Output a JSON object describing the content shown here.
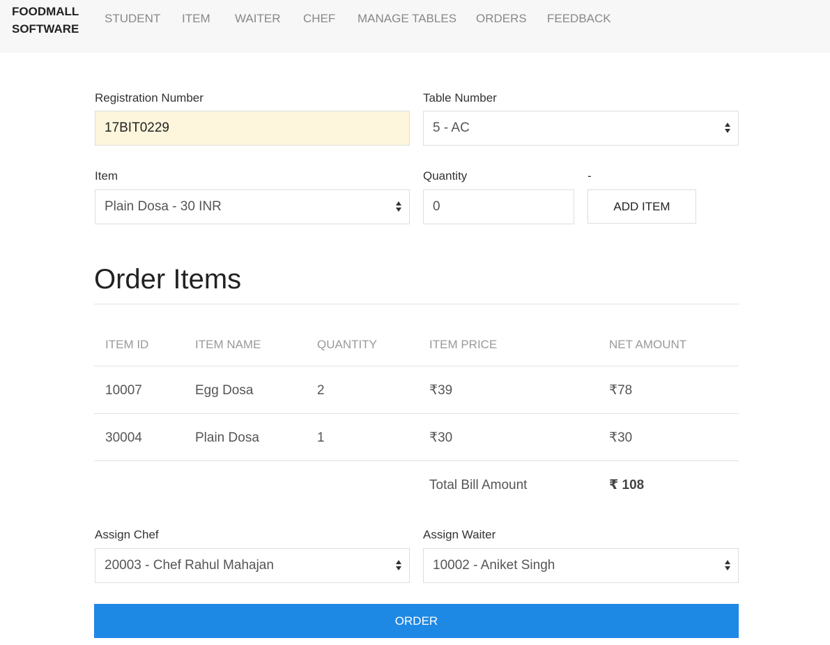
{
  "nav": {
    "brand": "FOODMALL SOFTWARE",
    "items": [
      "STUDENT",
      "ITEM",
      "WAITER",
      "CHEF",
      "MANAGE TABLES",
      "ORDERS",
      "FEEDBACK"
    ]
  },
  "form": {
    "registration_label": "Registration Number",
    "registration_value": "17BIT0229",
    "table_label": "Table Number",
    "table_value": "5 - AC",
    "item_label": "Item",
    "item_value": "Plain Dosa - 30 INR",
    "quantity_label": "Quantity",
    "quantity_value": "0",
    "add_label": "-",
    "add_button": "ADD ITEM"
  },
  "order_items": {
    "title": "Order Items",
    "columns": [
      "ITEM ID",
      "ITEM NAME",
      "QUANTITY",
      "ITEM PRICE",
      "NET AMOUNT"
    ],
    "rows": [
      [
        "10007",
        "Egg Dosa",
        "2",
        "₹39",
        "₹78"
      ],
      [
        "30004",
        "Plain Dosa",
        "1",
        "₹30",
        "₹30"
      ]
    ],
    "total_label": "Total Bill Amount",
    "total_value": "₹ 108"
  },
  "assign": {
    "chef_label": "Assign Chef",
    "chef_value": "20003 - Chef Rahul Mahajan",
    "waiter_label": "Assign Waiter",
    "waiter_value": "10002 - Aniket Singh"
  },
  "order_button": "ORDER"
}
